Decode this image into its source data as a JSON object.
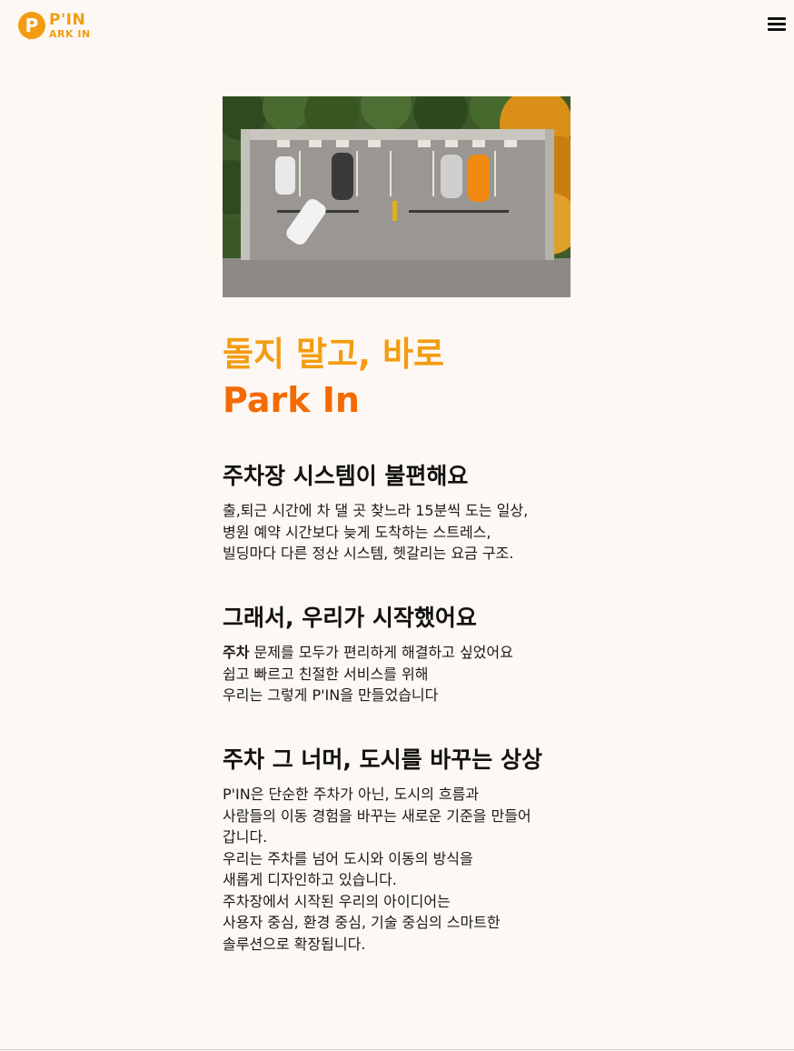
{
  "header": {
    "logo_mark": "P",
    "logo_top": "P'IN",
    "logo_bottom": "ARK IN"
  },
  "hero": {
    "alt": "Aerial view of smart parking lot"
  },
  "headline": {
    "line1": "돌지 말고, 바로",
    "line2": "Park In"
  },
  "sections": [
    {
      "title": "주차장 시스템이 불편해요",
      "lines": [
        "출,퇴근 시간에 차 댈 곳 찾느라 15분씩 도는 일상,",
        "병원 예약 시간보다 늦게 도착하는 스트레스,",
        "빌딩마다 다른 정산 시스템, 헷갈리는 요금 구조."
      ]
    },
    {
      "title": "그래서, 우리가 시작했어요",
      "lines_first_bold": "주차",
      "lines_first_rest": " 문제를 모두가 편리하게 해결하고 싶었어요",
      "lines": [
        "쉽고 빠르고 친절한 서비스를 위해",
        "우리는 그렇게 P'IN을 만들었습니다"
      ]
    },
    {
      "title": "주차 그 너머, 도시를 바꾸는 상상",
      "lines": [
        "P'IN은 단순한 주차가 아닌, 도시의 흐름과",
        "사람들의 이동 경험을 바꾸는 새로운 기준을 만들어",
        "갑니다.",
        "우리는 주차를 넘어 도시와 이동의 방식을",
        "새롭게 디자인하고 있습니다.",
        "주차장에서 시작된 우리의 아이디어는",
        "사용자 중심, 환경 중심, 기술 중심의 스마트한",
        "솔루션으로 확장됩니다."
      ]
    }
  ],
  "colors": {
    "brand": "#f39c12",
    "brand_dark": "#f26a00",
    "background": "#fdf8f3"
  }
}
